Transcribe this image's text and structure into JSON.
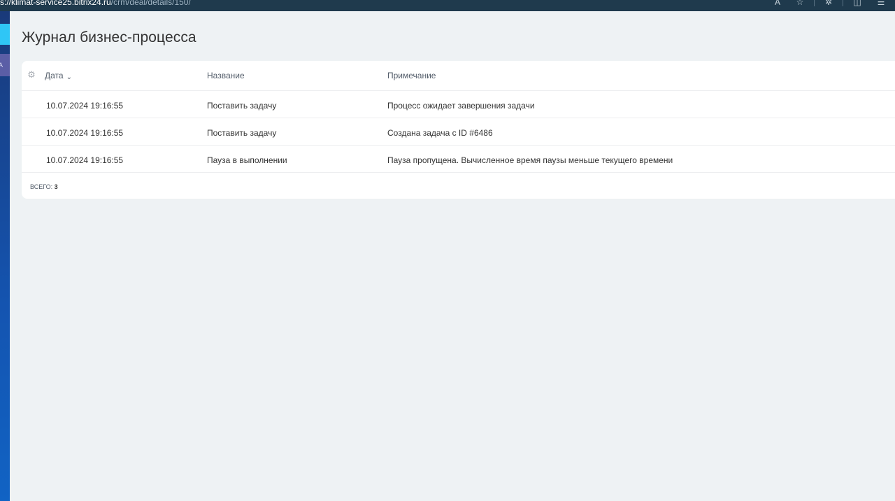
{
  "browser": {
    "url_prefix": "s://",
    "url_host": "klimat-service25.bitrix24.ru",
    "url_path": "/crm/deal/details/150/"
  },
  "page": {
    "title": "Журнал бизнес-процесса"
  },
  "sidebar": {
    "purple_item_letter": "А"
  },
  "grid": {
    "columns": {
      "date": "Дата",
      "name": "Название",
      "note": "Примечание"
    },
    "rows": [
      {
        "date": "10.07.2024 19:16:55",
        "name": "Поставить задачу",
        "note": "Процесс ожидает завершения задачи"
      },
      {
        "date": "10.07.2024 19:16:55",
        "name": "Поставить задачу",
        "note": "Создана задача с ID #6486"
      },
      {
        "date": "10.07.2024 19:16:55",
        "name": "Пауза в выполнении",
        "note": "Пауза пропущена. Вычисленное время паузы меньше текущего времени"
      }
    ],
    "total_label": "ВСЕГО:",
    "total_value": "3"
  },
  "colors": {
    "browser_bar": "#1f3a4d",
    "page_bg": "#eef2f4",
    "accent_cyan": "#2fc6f6",
    "accent_purple": "#5b5ea6"
  }
}
